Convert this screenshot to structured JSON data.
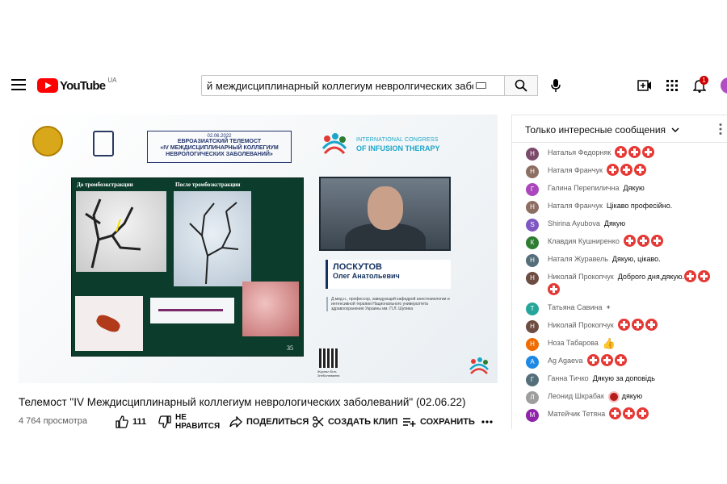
{
  "header": {
    "logo_text": "YouTube",
    "region": "UA",
    "search_value": "й междисциплинарный коллегиум невролгических заболеван",
    "notification_count": "1"
  },
  "slide": {
    "date": "02.06.2022",
    "telemost_line1": "ЕВРОАЗИАТСКИЙ ТЕЛЕМОСТ",
    "telemost_line2": "«IV МЕЖДИСЦИПЛИНАРНЫЙ КОЛЛЕГИУМ",
    "telemost_line3": "НЕВРОЛОГИЧЕСКИХ ЗАБОЛЕВАНИЙ»",
    "congress_line1": "INTERNATIONAL CONGRESS",
    "congress_line2": "OF INFUSION THERAPY",
    "before_caption": "До тромбоэкстракции",
    "after_caption": "После тромбоэкстракции",
    "slide_number": "35",
    "speaker_surname": "ЛОСКУТОВ",
    "speaker_name": "Олег Анатольевич",
    "speaker_bio": "Д.мед.н., профессор, заведующий кафедрой анестезиологии и интенсивной терапии Национального университета здравоохранения Украины им. П.Л. Шупика",
    "qr_caption": "Журнал Біль Знеболювання"
  },
  "video": {
    "title": "Телемост \"IV Междисциплинарный коллегиум неврологических заболеваний\" (02.06.22)",
    "views": "4 764 просмотра",
    "likes": "111",
    "dislike_line1": "НЕ",
    "dislike_line2": "НРАВИТСЯ",
    "share": "ПОДЕЛИТЬСЯ",
    "clip": "СОЗДАТЬ КЛИП",
    "save": "СОХРАНИТЬ"
  },
  "chat": {
    "filter_label": "Только интересные сообщения",
    "messages": [
      {
        "initial": "Н",
        "color": "#7b4a6a",
        "author": "Наталья Федорняк",
        "text": "",
        "emoji": 3
      },
      {
        "initial": "Н",
        "color": "#8d6e63",
        "author": "Наталя Франчук",
        "text": "",
        "emoji": 3
      },
      {
        "initial": "Г",
        "color": "#ab47bc",
        "author": "Галина Перепилична",
        "text": "Дякую",
        "emoji": 0
      },
      {
        "initial": "Н",
        "color": "#8d6e63",
        "author": "Наталя Франчук",
        "text": "Цікаво професійно.",
        "emoji": 0
      },
      {
        "initial": "S",
        "color": "#7e57c2",
        "author": "Shirina Ayubova",
        "text": "Дякую",
        "emoji": 0
      },
      {
        "initial": "К",
        "color": "#2e7d32",
        "author": "Клавдия Кушниренко",
        "text": "",
        "emoji": 3
      },
      {
        "initial": "Н",
        "color": "#546e7a",
        "author": "Наталя Журавель",
        "text": "Дякую, цікаво.",
        "emoji": 0
      },
      {
        "initial": "Н",
        "color": "#6d4c41",
        "author": "Николай Прокопчук",
        "text": "Доброго дня,дякую.",
        "emoji": 3
      },
      {
        "initial": "Т",
        "color": "#26a69a",
        "author": "Татьяна Савина",
        "text": "+",
        "emoji": 0
      },
      {
        "initial": "Н",
        "color": "#6d4c41",
        "author": "Николай Прокопчук",
        "text": "",
        "emoji": 3
      },
      {
        "initial": "Н",
        "color": "#ef6c00",
        "author": "Ноза Табарова",
        "text": "👍",
        "emoji": 0
      },
      {
        "initial": "A",
        "color": "#1e88e5",
        "author": "Ag Agaeva",
        "text": "",
        "emoji": 3
      },
      {
        "initial": "Г",
        "color": "#546e7a",
        "author": "Ганна Тичко",
        "text": "Дякую за доповідь",
        "emoji": 0
      },
      {
        "initial": "Л",
        "color": "#9e9e9e",
        "author": "Леонид Шкрабак",
        "text": "дякую",
        "emoji": 0
      },
      {
        "initial": "М",
        "color": "#8e24aa",
        "author": "Матейчик Тетяна",
        "text": "",
        "emoji": 3
      }
    ]
  }
}
